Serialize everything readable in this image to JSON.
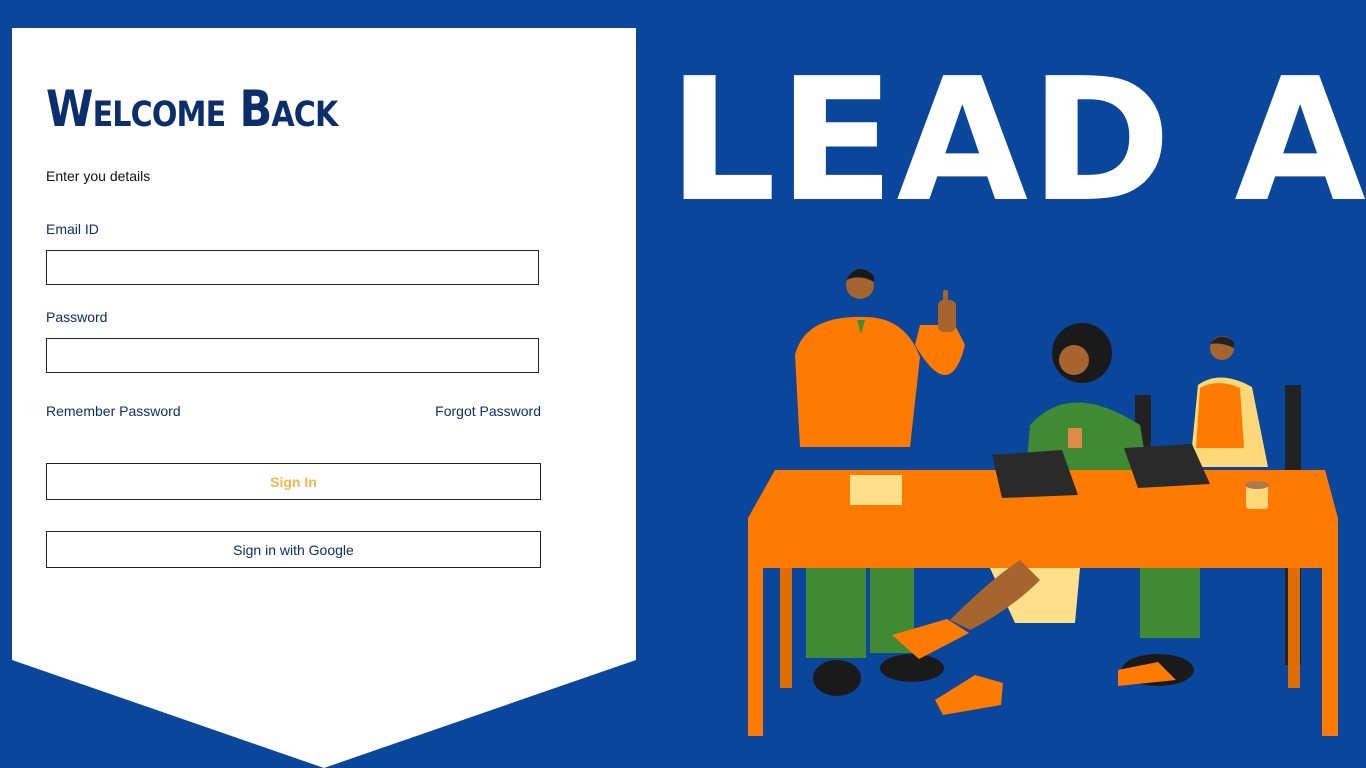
{
  "login": {
    "title": "Welcome Back",
    "subtitle": "Enter you details",
    "email_label": "Email ID",
    "email_value": "",
    "password_label": "Password",
    "password_value": "",
    "remember_label": "Remember Password",
    "forgot_label": "Forgot Password",
    "signin_label": "Sign In",
    "google_label": "Sign in with Google"
  },
  "brand": {
    "name": "LEAD AI"
  },
  "colors": {
    "background": "#0a469b",
    "panel": "#ffffff",
    "title": "#0b2f6b",
    "signin_text": "#f5b750",
    "illustration_orange": "#ff7a00",
    "illustration_green": "#3f8a32"
  },
  "illustration": {
    "name": "team-meeting-illustration"
  }
}
